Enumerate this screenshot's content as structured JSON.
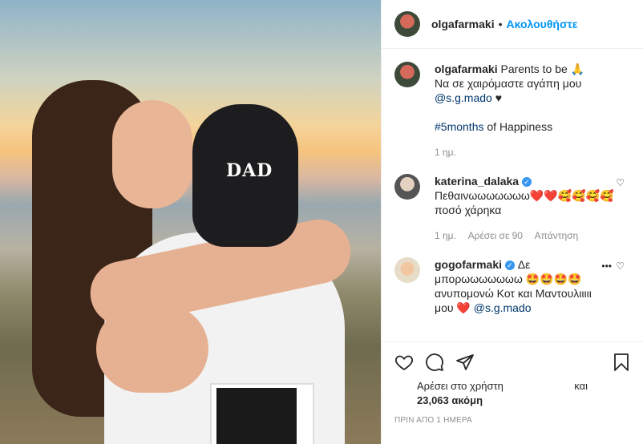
{
  "post": {
    "username": "olgafarmaki",
    "follow_label": "Ακολουθήστε",
    "photo_text": "DAD"
  },
  "caption": {
    "username": "olgafarmaki",
    "line1": "Parents to be 🙏",
    "line2": "Να σε χαιρόμαστε αγάπη μου",
    "mention": "@s.g.mado",
    "heart": "♥",
    "hashtag": "#5months",
    "hashtag_rest": " of Happiness",
    "time": "1 ημ."
  },
  "comments": [
    {
      "username": "katerina_dalaka",
      "text": "Πεθαινωωωωωωω❤️❤️🥰🥰🥰🥰 ποσό χάρηκα",
      "time": "1 ημ.",
      "likes": "Αρέσει σε 90",
      "reply": "Απάντηση"
    },
    {
      "username": "gogofarmaki",
      "text": "Δε μπορωωωωωωω 🤩🤩🤩🤩 ανυπομονώ Κοτ και Μαντουλιιιιι μου ❤️",
      "mention": "@s.g.mado"
    }
  ],
  "actions": {
    "likes_line1": "Αρέσει στο χρήστη",
    "likes_and": "και",
    "likes_line2": "23,063 ακόμη",
    "timestamp": "ΠΡΙΝ ΑΠΟ 1 ΗΜΕΡΑ"
  },
  "colors": {
    "accent": "#0095f6",
    "mention": "#00376b",
    "muted": "#8e8e8e",
    "heart": "#ed4956"
  }
}
